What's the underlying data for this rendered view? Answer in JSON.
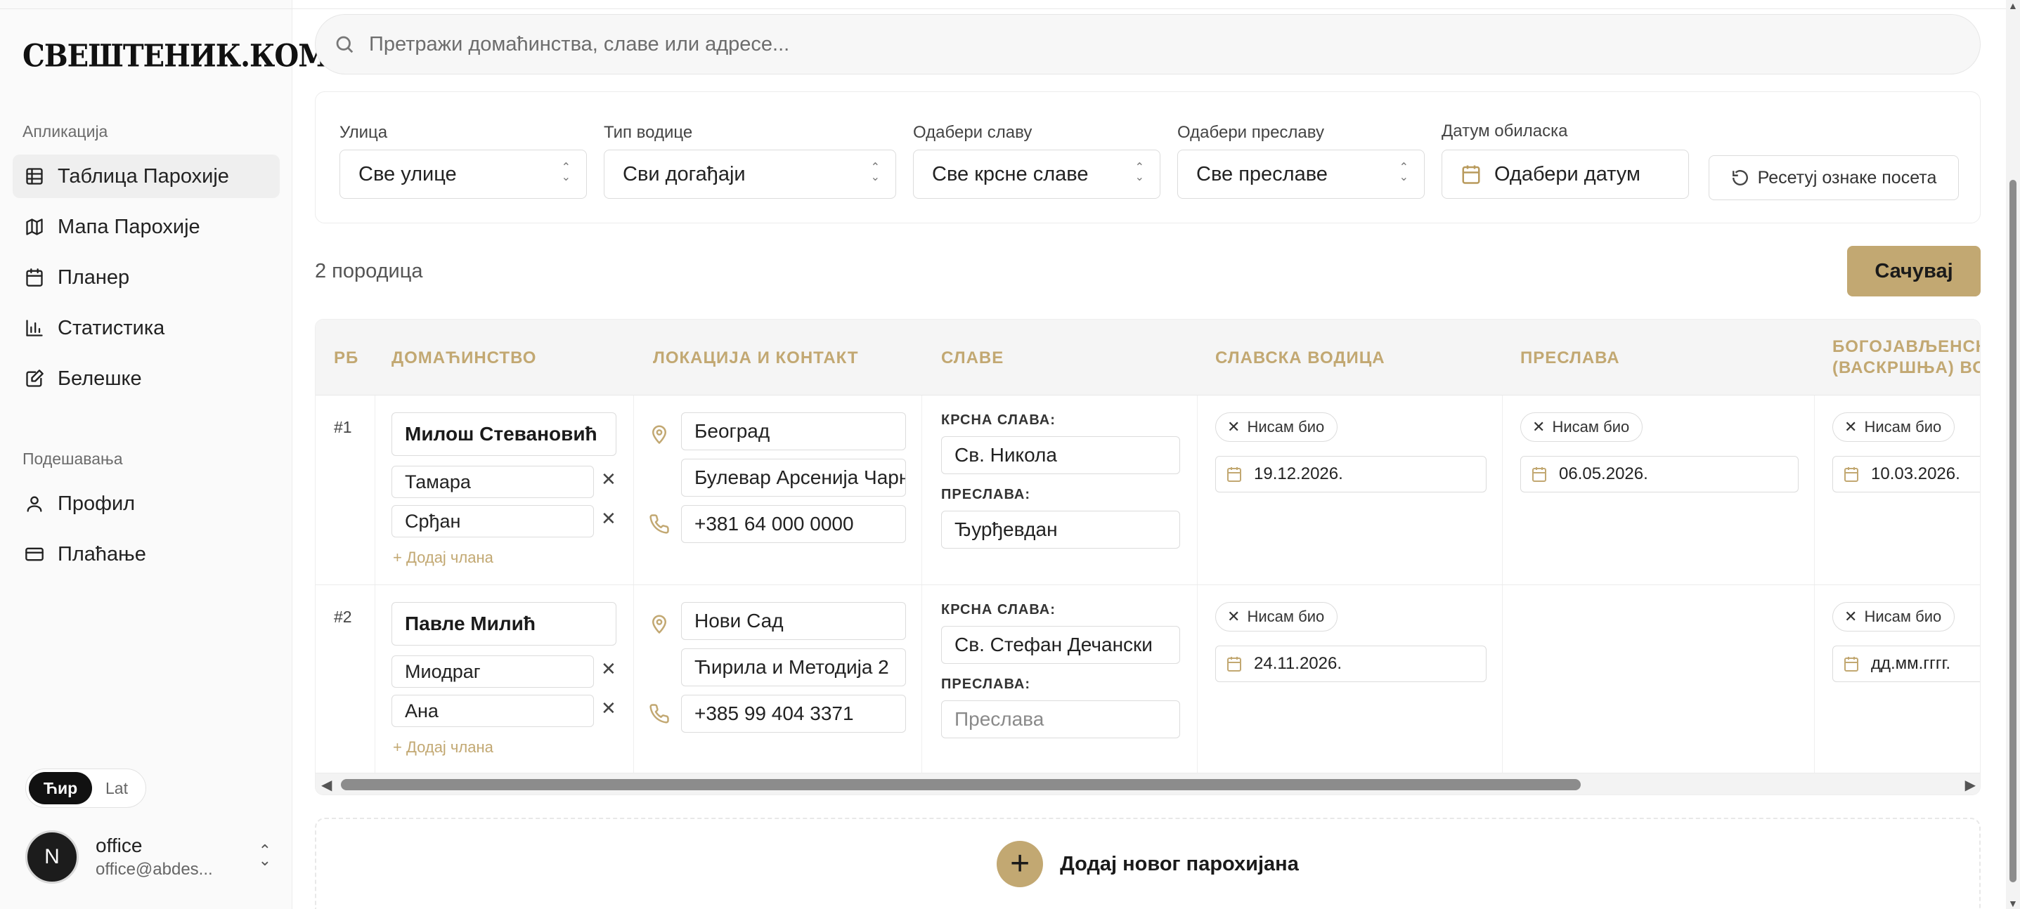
{
  "sidebar": {
    "logo": "СВЕШТЕНИК.КОМ",
    "section_app": "Апликација",
    "app_items": [
      {
        "label": "Таблица Парохије",
        "icon": "table-icon",
        "active": true
      },
      {
        "label": "Мапа Парохије",
        "icon": "map-icon",
        "active": false
      },
      {
        "label": "Планер",
        "icon": "calendar-icon",
        "active": false
      },
      {
        "label": "Статистика",
        "icon": "bar-chart-icon",
        "active": false
      },
      {
        "label": "Белешке",
        "icon": "notes-icon",
        "active": false
      }
    ],
    "section_settings": "Подешавања",
    "settings_items": [
      {
        "label": "Профил",
        "icon": "user-icon"
      },
      {
        "label": "Плаћање",
        "icon": "credit-card-icon"
      }
    ],
    "lang": {
      "cyr": "Ћир",
      "lat": "Lat",
      "active": "cyr"
    },
    "user": {
      "initial": "N",
      "name": "office",
      "email": "office@abdes..."
    }
  },
  "search": {
    "placeholder": "Претражи домаћинства, славе или адресе..."
  },
  "filters": {
    "street": {
      "label": "Улица",
      "value": "Све улице"
    },
    "water": {
      "label": "Тип водице",
      "value": "Сви догађаји"
    },
    "slava": {
      "label": "Одабери славу",
      "value": "Све крсне славе"
    },
    "preslava": {
      "label": "Одабери преславу",
      "value": "Све преславе"
    },
    "date": {
      "label": "Датум обиласка",
      "value": "Одабери датум"
    },
    "reset_label": "Ресетуј ознаке посета"
  },
  "count_label": "2 породица",
  "save_label": "Сачувај",
  "table": {
    "headers": {
      "rb": "РБ",
      "household": "ДОМАЋИНСТВО",
      "location": "ЛОКАЦИЈА И КОНТАКТ",
      "slave": "СЛАВЕ",
      "slava_water": "СЛАВСКА ВОДИЦА",
      "preslava": "ПРЕСЛАВА",
      "epiphany_1": "БОГОЈАВЉЕНСК",
      "epiphany_2": "(ВАСКРШЊА) ВО"
    },
    "add_member_label": "+ Додај члана",
    "krsna_label": "КРСНА СЛАВА:",
    "preslava_label": "ПРЕСЛАВА:",
    "rows": [
      {
        "rb": "#1",
        "head": "Милош Стевановић",
        "members": [
          "Тамара",
          "Срђан"
        ],
        "city": "Београд",
        "address": "Булевар Арсенија Чарнојевића",
        "phone": "+381 64 000 0000",
        "krsna_slava": "Св. Никола",
        "preslava": "Ђурђевдан",
        "preslava_placeholder": false,
        "water_status": "Нисам био",
        "water_date": "19.12.2026.",
        "preslava_status": "Нисам био",
        "preslava_date": "06.05.2026.",
        "epiphany_status": "Нисам био",
        "epiphany_date": "10.03.2026."
      },
      {
        "rb": "#2",
        "head": "Павле Милић",
        "members": [
          "Миодраг",
          "Ана"
        ],
        "city": "Нови Сад",
        "address": "Ћирила и Методија 2",
        "phone": "+385 99 404 3371",
        "krsna_slava": "Св. Стефан Дечански",
        "preslava": "Преслава",
        "preslava_placeholder": true,
        "water_status": "Нисам био",
        "water_date": "24.11.2026.",
        "preslava_status": "",
        "preslava_date": "",
        "epiphany_status": "Нисам био",
        "epiphany_date": "дд.мм.гггг."
      }
    ]
  },
  "add_parishioner_label": "Додај новог парохијана"
}
